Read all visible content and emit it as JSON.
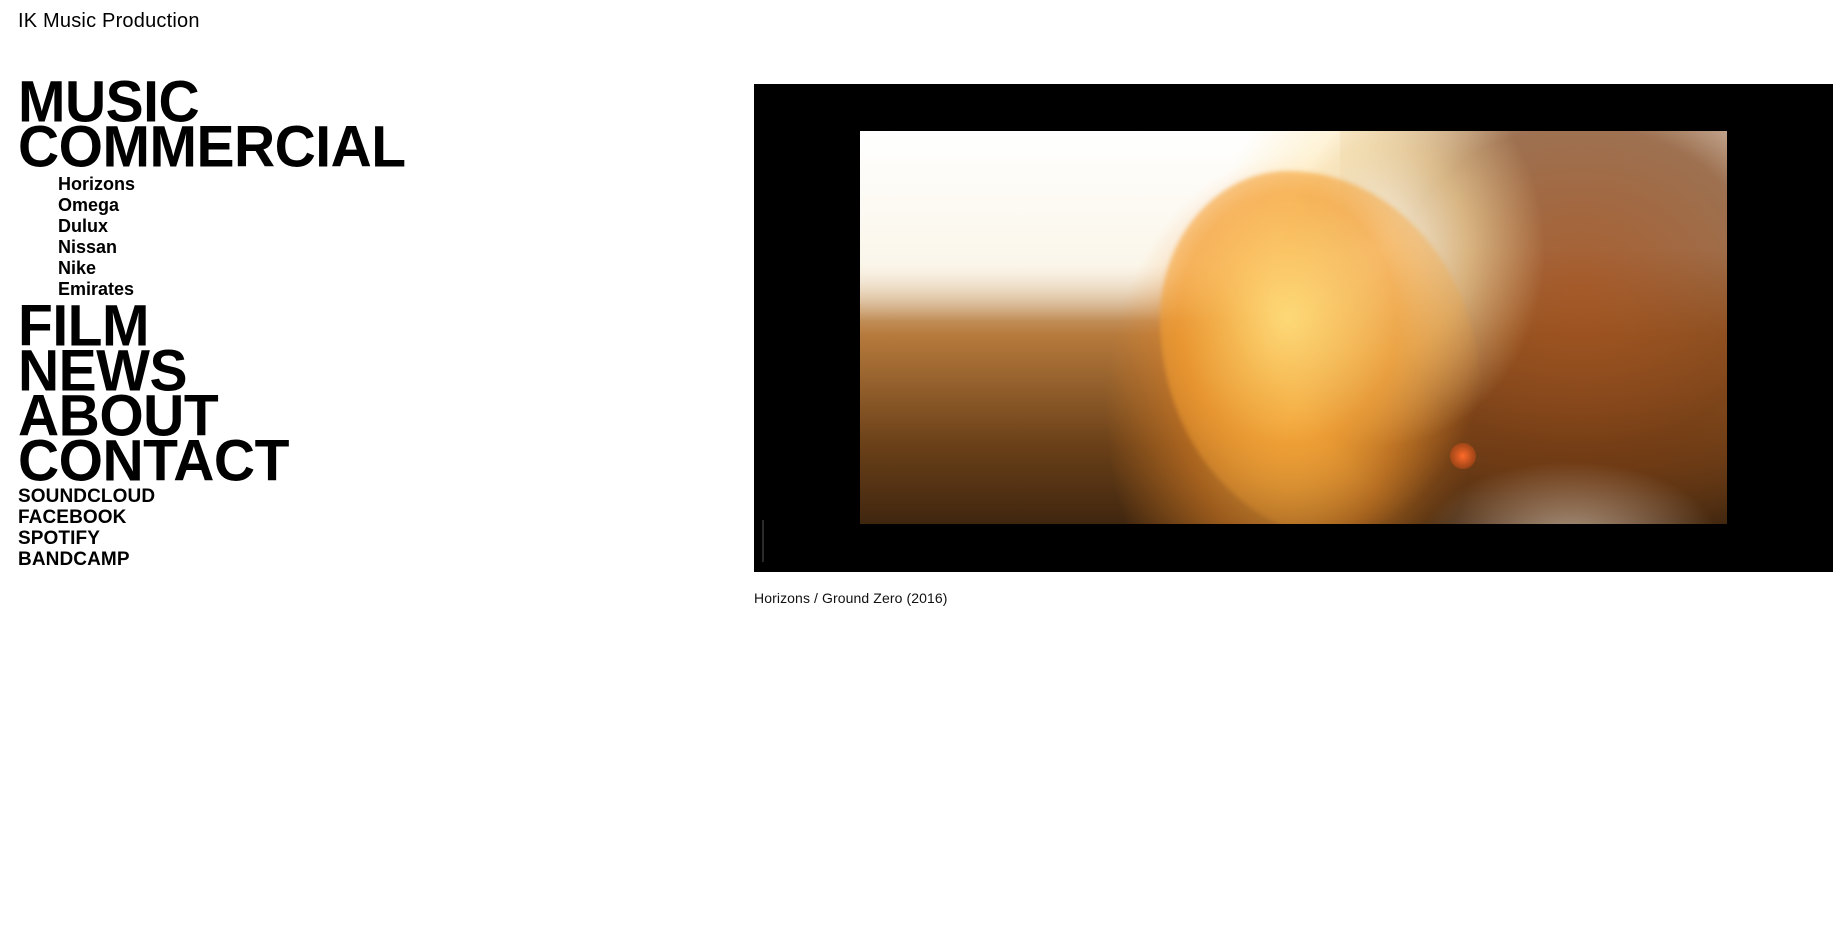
{
  "site": {
    "title": "IK Music Production"
  },
  "nav": {
    "music": "MUSIC",
    "commercial": "COMMERCIAL",
    "commercial_items": [
      "Horizons",
      "Omega",
      "Dulux",
      "Nissan",
      "Nike",
      "Emirates"
    ],
    "film": "FILM",
    "news": "NEWS",
    "about": "ABOUT",
    "contact": "CONTACT"
  },
  "social": {
    "items": [
      "SOUNDCLOUD",
      "FACEBOOK",
      "SPOTIFY",
      "BANDCAMP"
    ]
  },
  "video": {
    "caption": "Horizons / Ground Zero (2016)"
  },
  "colors": {
    "background": "#ffffff",
    "text": "#000000",
    "video_frame": "#000000"
  }
}
